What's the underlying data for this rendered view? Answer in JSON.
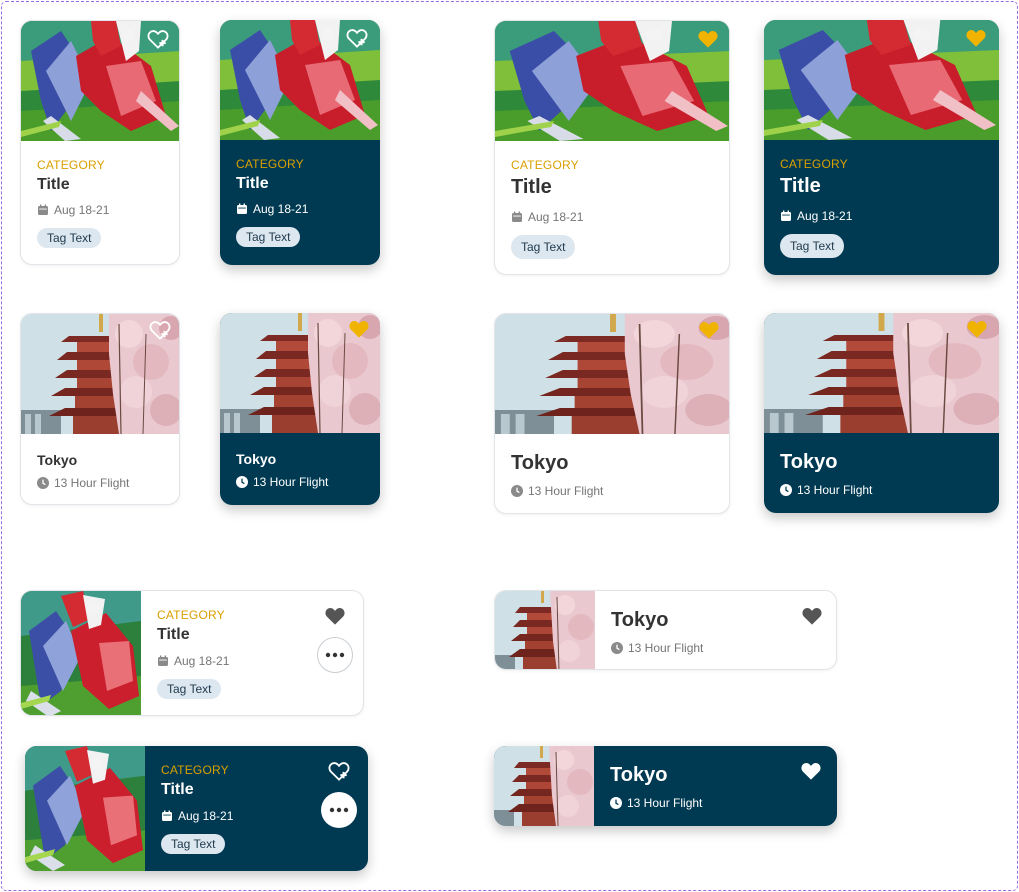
{
  "colors": {
    "dark_card": "#003a52",
    "category": "#d9a000",
    "favorite_active": "#f0b400",
    "tag_bg": "#dde7f0",
    "border": "#e1e4e8"
  },
  "event_card": {
    "category": "CATEGORY",
    "title": "Title",
    "date": "Aug 18-21",
    "tag": "Tag Text",
    "image_icon": "polo-horse-painting",
    "date_icon": "calendar-icon"
  },
  "destination_card": {
    "title": "Tokyo",
    "duration": "13 Hour Flight",
    "image_icon": "pagoda-cherry-blossom-photo",
    "duration_icon": "clock-icon"
  },
  "favorite_states": {
    "outline_add": "heart-plus-outline-icon",
    "active": "heart-filled-gold-icon",
    "filled_gray": "heart-filled-gray-icon",
    "filled_white": "heart-filled-white-icon"
  },
  "more_button_icon": "ellipsis-icon"
}
